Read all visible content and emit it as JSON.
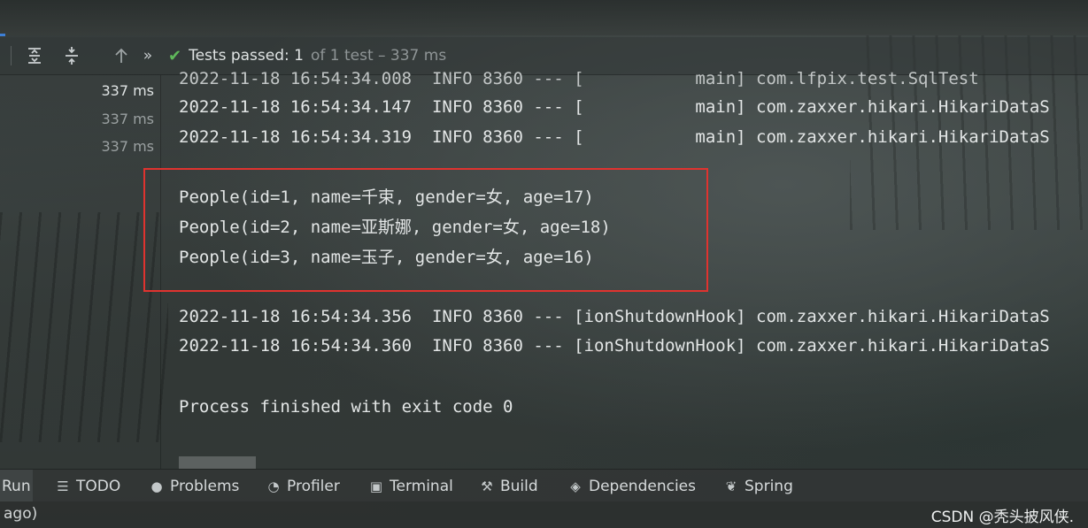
{
  "toolbar": {
    "status_passed": "Tests passed: 1",
    "status_rest": "of 1 test – 337 ms"
  },
  "left_panel": {
    "durations": [
      "337 ms",
      "337 ms",
      "337 ms"
    ]
  },
  "console": {
    "lines": [
      "2022-11-18 16:54:34.008  INFO 8360 --- [           main] com.lfpix.test.SqlTest",
      "2022-11-18 16:54:34.147  INFO 8360 --- [           main] com.zaxxer.hikari.HikariDataS",
      "2022-11-18 16:54:34.319  INFO 8360 --- [           main] com.zaxxer.hikari.HikariDataS",
      "People(id=1, name=千束, gender=女, age=17)",
      "People(id=2, name=亚斯娜, gender=女, age=18)",
      "People(id=3, name=玉子, gender=女, age=16)",
      "2022-11-18 16:54:34.356  INFO 8360 --- [ionShutdownHook] com.zaxxer.hikari.HikariDataS",
      "2022-11-18 16:54:34.360  INFO 8360 --- [ionShutdownHook] com.zaxxer.hikari.HikariDataS",
      "Process finished with exit code 0"
    ]
  },
  "bottom_tabs": {
    "run": "Run",
    "todo": "TODO",
    "problems": "Problems",
    "profiler": "Profiler",
    "terminal": "Terminal",
    "build": "Build",
    "dependencies": "Dependencies",
    "spring": "Spring"
  },
  "statusline": {
    "message": "ago)",
    "watermark": "CSDN @秃头披风侠."
  },
  "colors": {
    "pass_green": "#5fb85a",
    "highlight_red": "#e0332f"
  }
}
